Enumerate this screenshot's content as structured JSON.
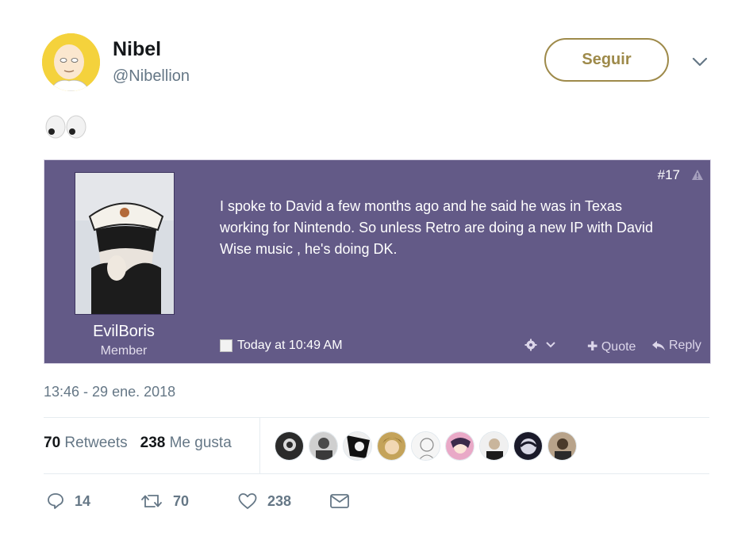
{
  "user": {
    "display_name": "Nibel",
    "handle": "@Nibellion"
  },
  "follow_label": "Seguir",
  "tweet": {
    "text_icon": "eyes-emoji"
  },
  "embed": {
    "username": "EvilBoris",
    "user_title": "Member",
    "post_number": "#17",
    "body": "I spoke to David a few months ago and he said he was in Texas working for Nintendo. So unless Retro are doing a new IP with David Wise music , he's doing DK.",
    "date": "Today at 10:49 AM",
    "quote_label": "Quote",
    "reply_label": "Reply"
  },
  "timestamp": "13:46 - 29 ene. 2018",
  "stats": {
    "retweets_count": "70",
    "retweets_label": "Retweets",
    "likes_count": "238",
    "likes_label": "Me gusta"
  },
  "actions": {
    "replies": "14",
    "retweets": "70",
    "likes": "238"
  },
  "colors": {
    "accent": "#9e8a4a",
    "embed_bg": "#635a87",
    "secondary_text": "#657786"
  }
}
